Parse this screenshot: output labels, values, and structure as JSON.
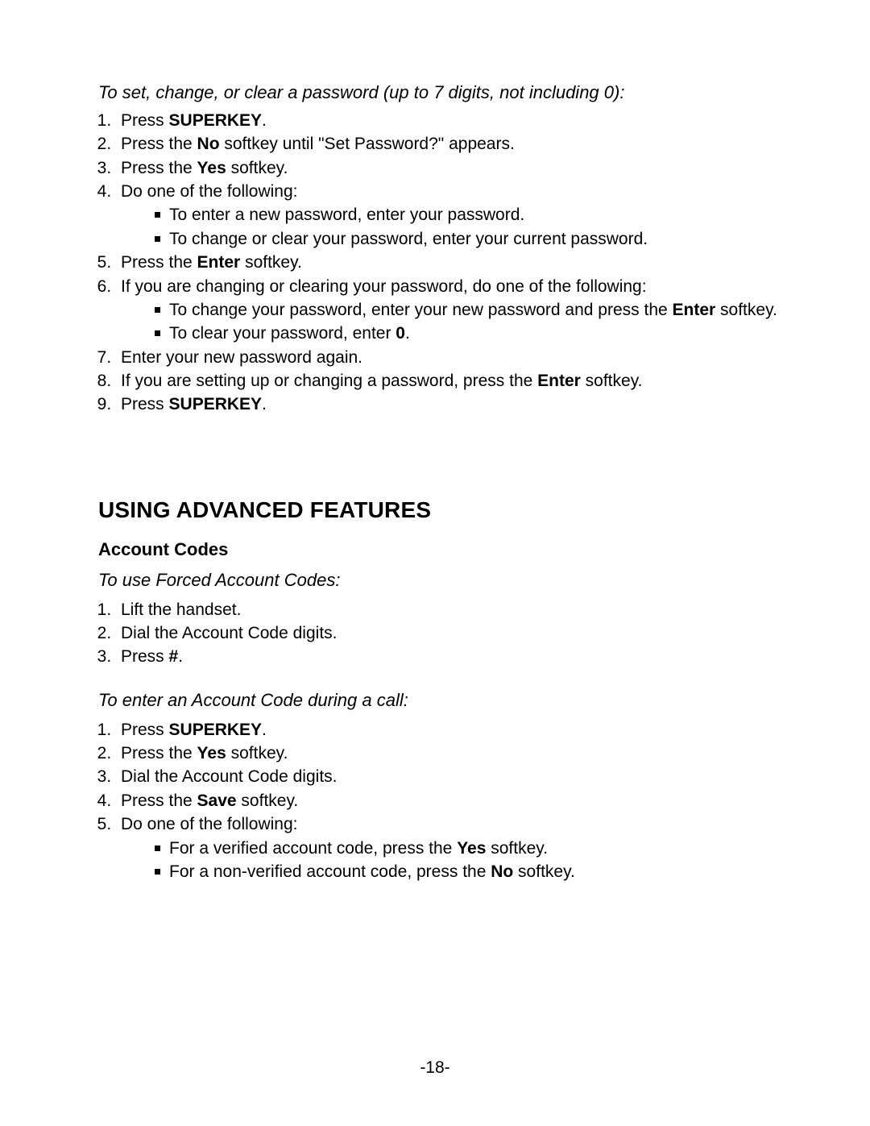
{
  "pageNumber": "-18-",
  "passwordBlock": {
    "heading": "To set, change, or clear a password (up to 7 digits, not including 0):",
    "step1_a": "Press ",
    "step1_b": "SUPERKEY",
    "step1_c": ".",
    "step2_a": "Press the ",
    "step2_b": "No",
    "step2_c": " softkey until \"Set Password?\" appears.",
    "step3_a": "Press the ",
    "step3_b": "Yes",
    "step3_c": " softkey.",
    "step4": "Do one of the following:",
    "step4_sub1": "To enter a new password, enter your password.",
    "step4_sub2": "To change or clear your password, enter your current password.",
    "step5_a": "Press the ",
    "step5_b": "Enter",
    "step5_c": " softkey.",
    "step6": "If you are changing or clearing your password, do one of the following:",
    "step6_sub1_a": "To change your password, enter your new password and press the ",
    "step6_sub1_b": "Enter",
    "step6_sub1_c": " softkey.",
    "step6_sub2_a": "To clear your password, enter ",
    "step6_sub2_b": "0",
    "step6_sub2_c": ".",
    "step7": "Enter your new password again.",
    "step8_a": "If you are setting up or changing a password, press the ",
    "step8_b": "Enter",
    "step8_c": " softkey.",
    "step9_a": "Press ",
    "step9_b": "SUPERKEY",
    "step9_c": "."
  },
  "advSection": {
    "title": "USING ADVANCED FEATURES",
    "sub1_title": "Account Codes",
    "forced": {
      "heading": "To use Forced Account Codes:",
      "s1": "Lift the handset.",
      "s2": "Dial the Account Code digits.",
      "s3_a": "Press ",
      "s3_b": "#",
      "s3_c": "."
    },
    "during": {
      "heading": "To enter an Account Code during a call:",
      "s1_a": "Press ",
      "s1_b": "SUPERKEY",
      "s1_c": ".",
      "s2_a": "Press the ",
      "s2_b": "Yes",
      "s2_c": " softkey.",
      "s3": "Dial the Account Code digits.",
      "s4_a": "Press the ",
      "s4_b": "Save",
      "s4_c": " softkey.",
      "s5": "Do one of the following:",
      "s5_sub1_a": "For a verified account code, press the ",
      "s5_sub1_b": "Yes",
      "s5_sub1_c": " softkey.",
      "s5_sub2_a": "For a non-verified account code, press the ",
      "s5_sub2_b": "No",
      "s5_sub2_c": " softkey."
    }
  }
}
